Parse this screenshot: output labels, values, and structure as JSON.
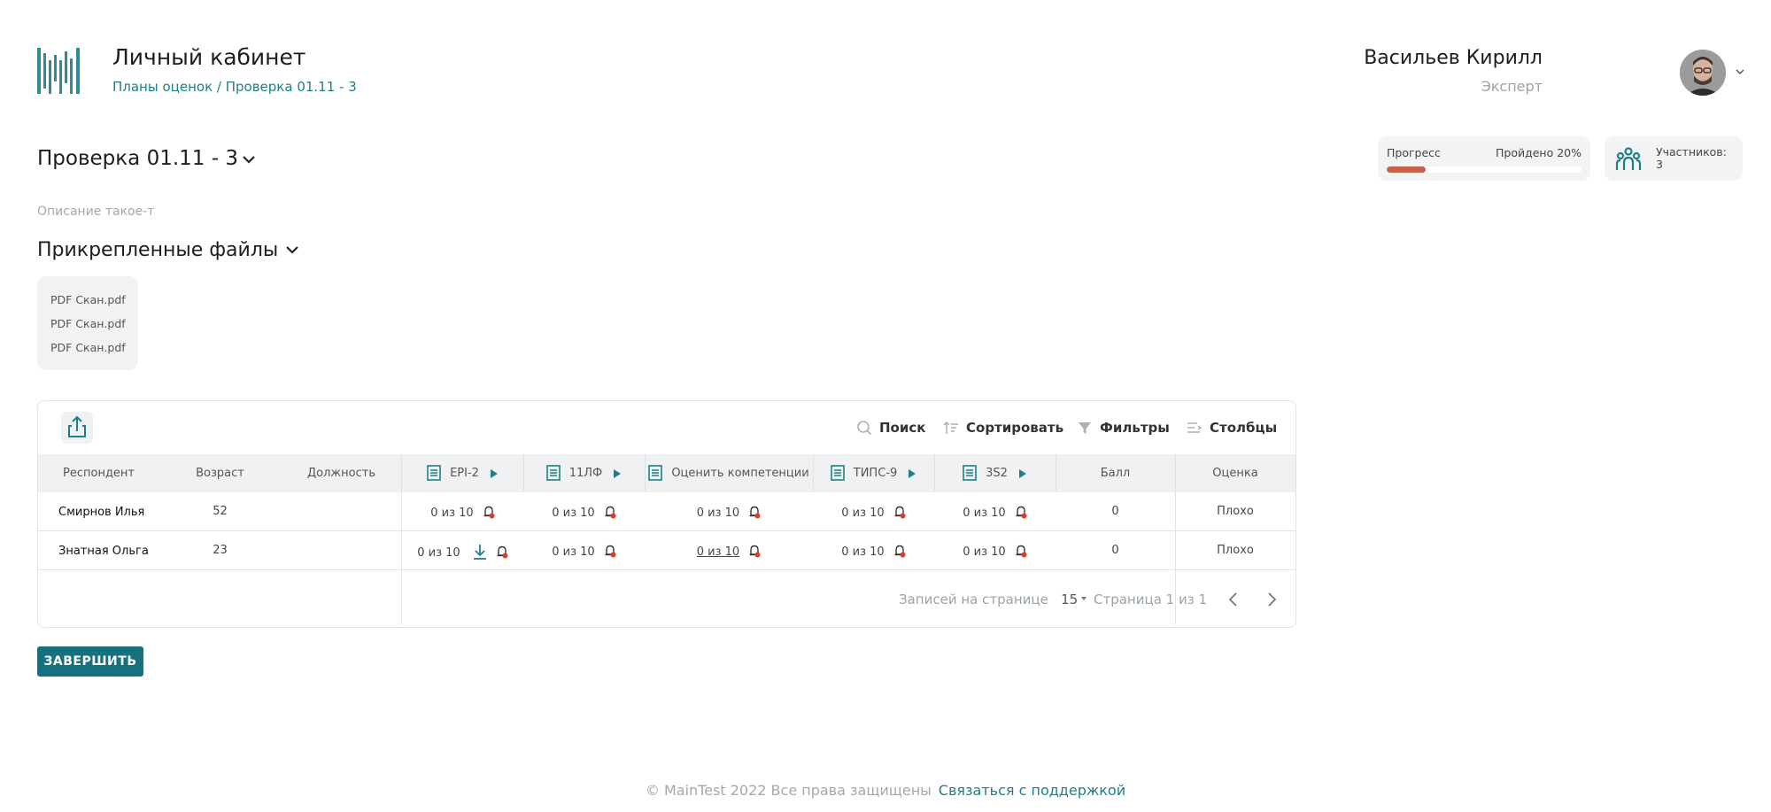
{
  "header": {
    "app_title": "Личный кабинет",
    "breadcrumb": "Планы оценок / Проверка 01.11 - 3",
    "user_name": "Васильев Кирилл",
    "user_role": "Эксперт",
    "logo_icon": "mt-logo-icon",
    "avatar_caret_icon": "chevron-down-icon"
  },
  "plan": {
    "title": "Проверка 01.11 - 3",
    "description": "Описание такое-т",
    "files_title": "Прикрепленные файлы",
    "files": [
      "PDF Скан.pdf",
      "PDF Скан.pdf",
      "PDF Скан.pdf"
    ]
  },
  "progress": {
    "label": "Прогресс",
    "done_label": "Пройдено 20%",
    "fraction": 0.2,
    "bar_color": "#c9604a"
  },
  "members": {
    "label": "Участников:",
    "count": "3"
  },
  "toolbar": {
    "search": "Поиск",
    "sort": "Сортировать",
    "filters": "Фильтры",
    "columns": "Столбцы"
  },
  "table": {
    "headers": {
      "respondent": "Респондент",
      "age": "Возраст",
      "position": "Должность",
      "t1": "EPI-2",
      "t2": "11ЛФ",
      "t3": "Оценить компетенции",
      "t4": "ТИПС-9",
      "t5": "3S2",
      "score": "Балл",
      "grade": "Оценка"
    },
    "rows": [
      {
        "name": "Смирнов Илья",
        "age": "52",
        "position": "",
        "t1": "0 из 10",
        "t2": "0 из 10",
        "t3": "0 из 10",
        "t4": "0 из 10",
        "t5": "0 из 10",
        "score": "0",
        "grade": "Плохо"
      },
      {
        "name": "Знатная Ольга",
        "age": "23",
        "position": "",
        "t1": "0 из 10",
        "t2": "0 из 10",
        "t3": "0 из 10",
        "t4": "0 из 10",
        "t5": "0 из 10",
        "score": "0",
        "grade": "Плохо"
      }
    ]
  },
  "pagination": {
    "per_page_label": "Записей на странице",
    "per_page_value": "15",
    "page_label": "Страница 1 из 1"
  },
  "actions": {
    "finish": "ЗАВЕРШИТЬ"
  },
  "footer": {
    "copyright": "© MainTest 2022 Все права защищены",
    "support": "Связаться с поддержкой"
  },
  "colors": {
    "accent": "#1f7f87",
    "button": "#17707e",
    "alert": "#d6402b"
  }
}
